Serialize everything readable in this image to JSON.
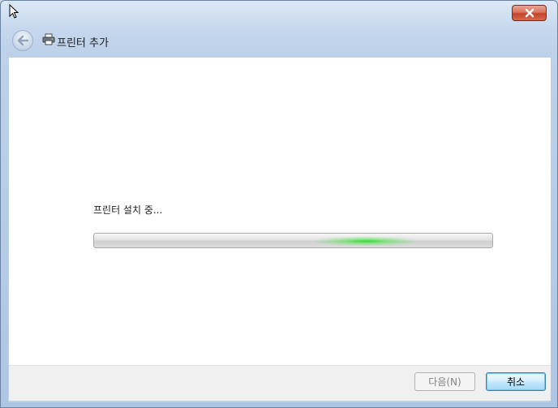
{
  "window": {
    "title": "프린터 추가",
    "close_icon": "close-icon",
    "back_icon": "back-arrow-icon",
    "title_icon": "printer-icon"
  },
  "main": {
    "status": "프린터 설치 중...",
    "progress": "indeterminate (marquee)"
  },
  "footer": {
    "next_label": "다음(N)",
    "next_enabled": false,
    "cancel_label": "취소"
  },
  "colors": {
    "progress_glow": "#28dc28",
    "close_button": "#c6432b",
    "default_button_border": "#3c7fb1"
  }
}
